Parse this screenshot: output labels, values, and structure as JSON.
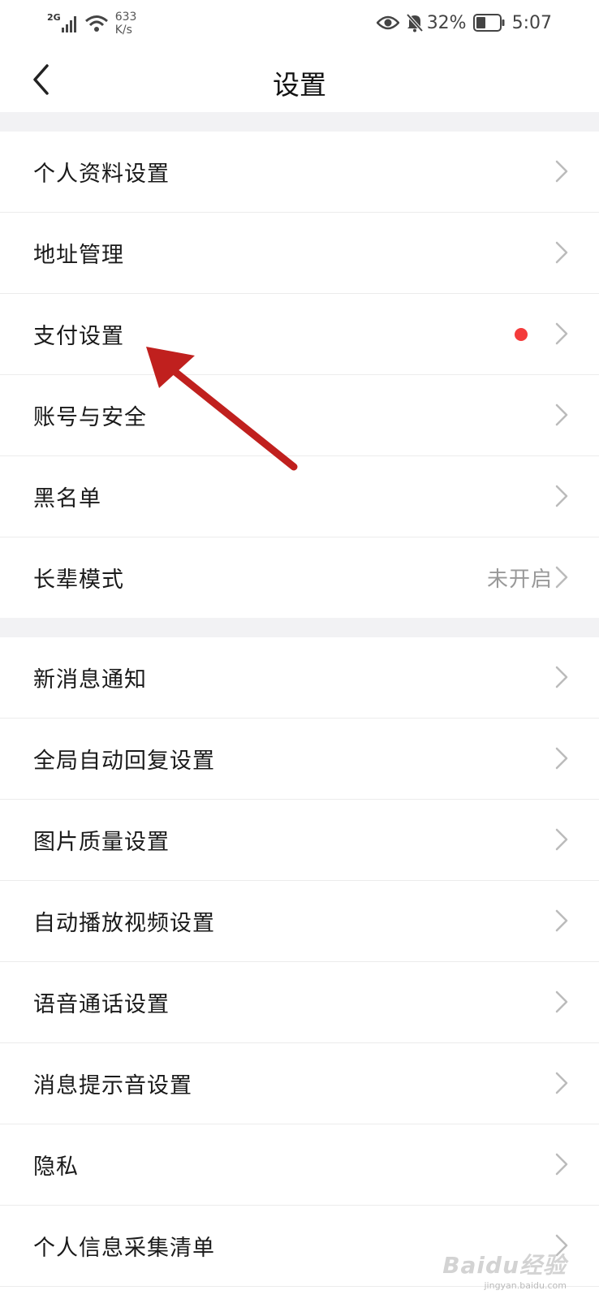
{
  "status_bar": {
    "network_type": "2G",
    "speed_value": "633",
    "speed_unit": "K/s",
    "battery": "32%",
    "time": "5:07"
  },
  "header": {
    "title": "设置"
  },
  "groups": [
    {
      "items": [
        {
          "label": "个人资料设置"
        },
        {
          "label": "地址管理"
        },
        {
          "label": "支付设置",
          "badge": "red-dot"
        },
        {
          "label": "账号与安全"
        },
        {
          "label": "黑名单"
        },
        {
          "label": "长辈模式",
          "value": "未开启"
        }
      ]
    },
    {
      "items": [
        {
          "label": "新消息通知"
        },
        {
          "label": "全局自动回复设置"
        },
        {
          "label": "图片质量设置"
        },
        {
          "label": "自动播放视频设置"
        },
        {
          "label": "语音通话设置"
        },
        {
          "label": "消息提示音设置"
        },
        {
          "label": "隐私"
        },
        {
          "label": "个人信息采集清单"
        }
      ]
    }
  ],
  "colors": {
    "separator_bg": "#f2f2f4",
    "red_dot": "#f43b3b",
    "annotation_arrow": "#c0201e"
  },
  "watermark": {
    "brand": "Baidu经验",
    "url": "jingyan.baidu.com"
  }
}
